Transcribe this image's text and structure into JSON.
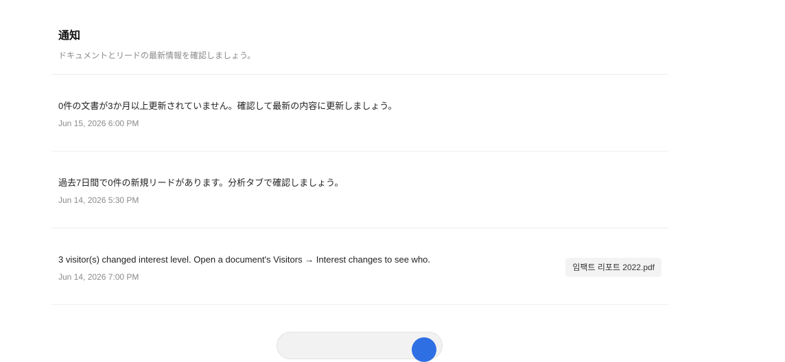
{
  "header": {
    "title": "通知",
    "subtitle": "ドキュメントとリードの最新情報を確認しましょう。"
  },
  "notifications": [
    {
      "text": "0件の文書が3か月以上更新されていません。確認して最新の内容に更新しましょう。",
      "time": "Jun 15, 2026 6:00 PM"
    },
    {
      "text": "過去7日間で0件の新規リードがあります。分析タブで確認しましょう。",
      "time": "Jun 14, 2026 5:30 PM"
    },
    {
      "text": "3 visitor(s) changed interest level. Open a document's Visitors → Interest changes to see who.",
      "time": "Jun 14, 2026 7:00 PM",
      "document": "임팩트 리포트 2022.pdf"
    }
  ],
  "colors": {
    "accent": "#2f6fe4",
    "divider": "#efefef",
    "muted_text": "#8a8a8a"
  }
}
